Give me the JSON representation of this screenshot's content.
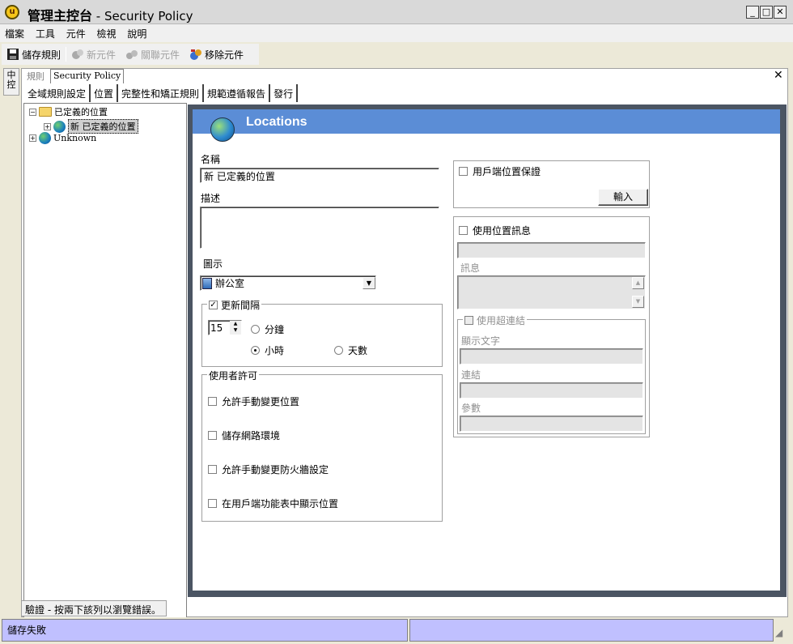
{
  "window": {
    "title_bold": "管理主控台",
    "title_rest": "- Security Policy"
  },
  "menu": [
    "檔案",
    "工具",
    "元件",
    "檢視",
    "說明"
  ],
  "toolbar": {
    "save": "儲存規則",
    "new_component": "新元件",
    "related": "關聯元件",
    "remove": "移除元件"
  },
  "sidetab": "中控",
  "doc_tabs": [
    "規則",
    "Security Policy"
  ],
  "sub_tabs": [
    "全域規則設定",
    "位置",
    "完整性和矯正規則",
    "規範遵循報告",
    "發行"
  ],
  "tree": {
    "root": "已定義的位置",
    "child": "新 已定義的位置",
    "unknown": "Unknown"
  },
  "pane": {
    "title": "Locations",
    "name_label": "名稱",
    "name_value": "新 已定義的位置",
    "desc_label": "描述",
    "desc_value": "",
    "icon_label": "圖示",
    "icon_value": "辦公室",
    "update_interval": "更新間隔",
    "interval_value": "15",
    "unit_minutes": "分鐘",
    "unit_hours": "小時",
    "unit_days": "天數",
    "user_permissions": "使用者許可",
    "perm1": "允許手動變更位置",
    "perm2": "儲存網路環境",
    "perm3": "允許手動變更防火牆設定",
    "perm4": "在用戶端功能表中顯示位置",
    "client_assurance": "用戶端位置保證",
    "import_button": "輸入",
    "use_message": "使用位置訊息",
    "message_label": "訊息",
    "use_hyperlink": "使用超連結",
    "display_text": "顯示文字",
    "link": "連結",
    "params": "參數"
  },
  "status": {
    "validation": "驗證 - 按兩下該列以瀏覽錯誤。",
    "save_fail": "儲存失敗"
  }
}
